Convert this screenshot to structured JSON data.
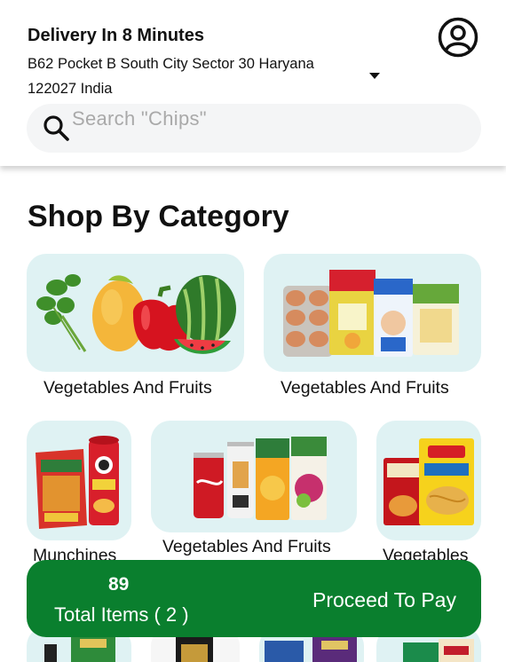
{
  "header": {
    "delivery_title": "Delivery In 8 Minutes",
    "address": "B62 Pocket B South City Sector 30 Haryana 122027 India",
    "profile_icon": "user-circle-icon"
  },
  "search": {
    "placeholder": "Search \"Chips\"",
    "icon": "search-icon"
  },
  "section": {
    "title": "Shop By Category"
  },
  "categories": [
    {
      "label": "Vegetables And Fruits"
    },
    {
      "label": "Vegetables And Fruits"
    },
    {
      "label": "Munchines"
    },
    {
      "label": "Vegetables And Fruits"
    },
    {
      "label": "Vegetables"
    }
  ],
  "cart": {
    "price": "89",
    "items_label": "Total Items ( 2 )",
    "proceed_label": "Proceed To Pay",
    "color": "#0a7f2e"
  },
  "colors": {
    "card_bg": "#dff2f3",
    "search_bg": "#f4f5f6"
  }
}
